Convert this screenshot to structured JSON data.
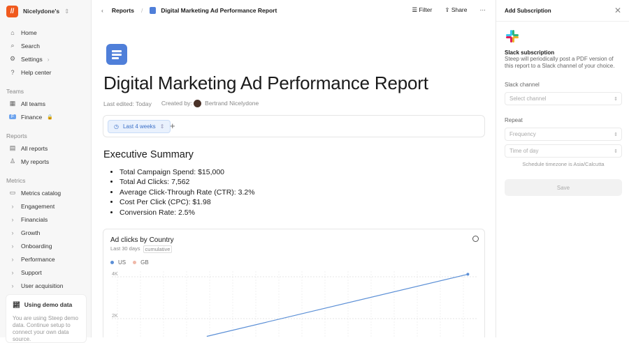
{
  "sidebar": {
    "workspace": "Nicelydone's",
    "logo_letter": "//",
    "main": [
      {
        "label": "Home",
        "icon": "⌂"
      },
      {
        "label": "Search",
        "icon": "⌕"
      },
      {
        "label": "Settings",
        "icon": "⚙"
      },
      {
        "label": "Help center",
        "icon": "?"
      }
    ],
    "teams_header": "Teams",
    "teams": [
      {
        "label": "All teams"
      },
      {
        "label": "Finance",
        "badge": "F"
      }
    ],
    "reports_header": "Reports",
    "reports": [
      {
        "label": "All reports"
      },
      {
        "label": "My reports"
      }
    ],
    "metrics_header": "Metrics",
    "metrics_catalog": "Metrics catalog",
    "metrics": [
      "Engagement",
      "Financials",
      "Growth",
      "Onboarding",
      "Performance",
      "Support",
      "User acquisition"
    ],
    "demo": {
      "title": "Using demo data",
      "text": "You are using Steep demo data. Continue setup to connect your own data source."
    }
  },
  "header": {
    "breadcrumb_root": "Reports",
    "breadcrumb_current": "Digital Marketing Ad Performance Report",
    "filter": "Filter",
    "share": "Share",
    "more": "···"
  },
  "report": {
    "title": "Digital Marketing Ad Performance Report",
    "last_edited": "Last edited: Today",
    "created_by_label": "Created by:",
    "author": "Bertrand Nicelydone",
    "date_filter": "Last 4 weeks",
    "add": "+",
    "summary_title": "Executive Summary",
    "summary": [
      "Total Campaign Spend: $15,000",
      "Total Ad Clicks: 7,562",
      "Average Click-Through Rate (CTR): 3.2%",
      "Cost Per Click (CPC): $1.98",
      "Conversion Rate: 2.5%"
    ]
  },
  "chart_data": {
    "type": "line",
    "title": "Ad clicks by Country",
    "subtitle": "Last 30 days",
    "badge": "cumulative",
    "legend": [
      "US",
      "GB"
    ],
    "colors": {
      "US": "#5b8fd6",
      "GB": "#f0b8a8"
    },
    "yticks": [
      "4K",
      "2K"
    ],
    "ylim": [
      0,
      4800
    ],
    "series": [
      {
        "name": "US",
        "x": [
          8,
          30
        ],
        "values": [
          1150,
          4120
        ]
      }
    ],
    "xlim": [
      0,
      30.8
    ]
  },
  "panel": {
    "title": "Add Subscription",
    "slack_title": "Slack subscription",
    "slack_text": "Steep will periodically post a PDF version of this report to a Slack channel of your choice.",
    "channel_label": "Slack channel",
    "channel_placeholder": "Select channel",
    "repeat_label": "Repeat",
    "frequency_placeholder": "Frequency",
    "time_placeholder": "Time of day",
    "timezone": "Schedule timezone is Asia/Calcutta",
    "save": "Save"
  }
}
